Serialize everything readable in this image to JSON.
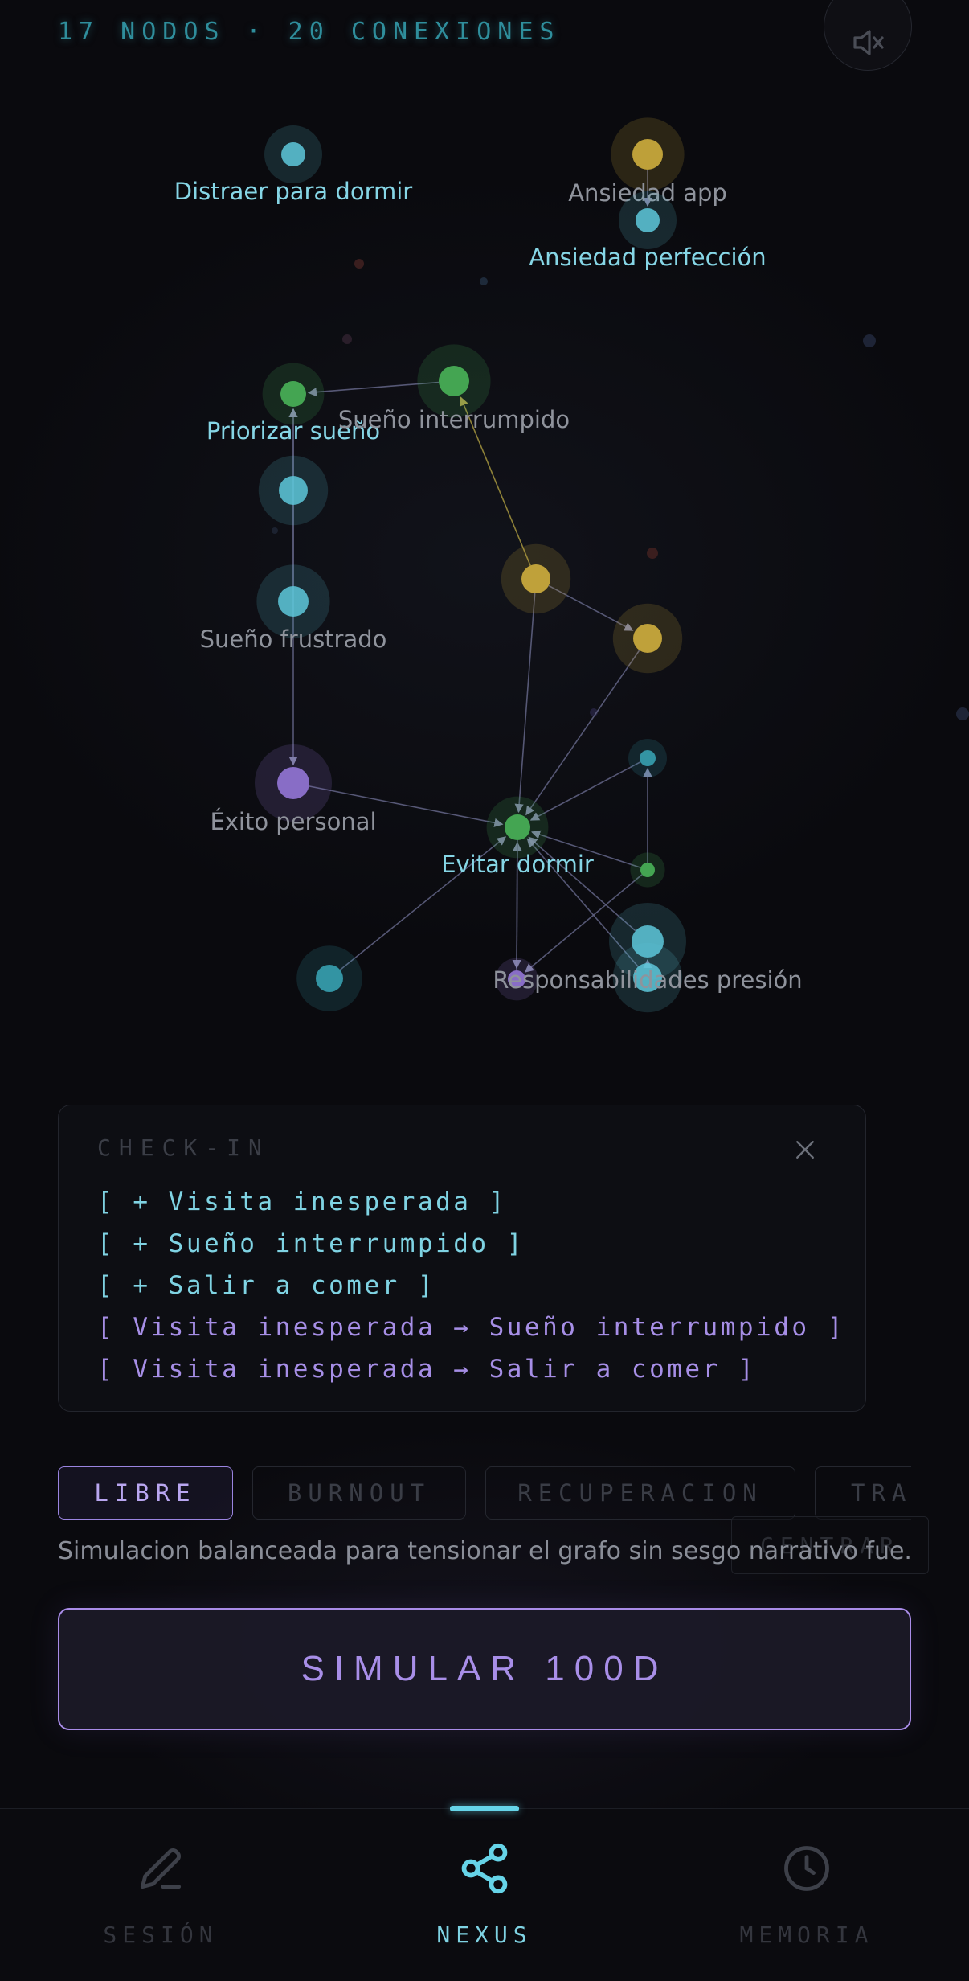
{
  "header": {
    "counts": "17 NODOS · 20 CONEXIONES"
  },
  "colors": {
    "cyan": "#5ec8da",
    "green": "#4cbb5c",
    "yellow": "#d8b640",
    "purple": "#9a7be0",
    "teal": "#3aa8b8"
  },
  "graph": {
    "nodes": [
      {
        "id": "n1",
        "label": "Distraer para dormir",
        "color": "cyan",
        "label_style": "cyan"
      },
      {
        "id": "n2",
        "label": "Ansiedad app",
        "color": "yellow",
        "label_style": "gray"
      },
      {
        "id": "n3",
        "label": "Ansiedad perfección",
        "color": "cyan",
        "label_style": "cyan"
      },
      {
        "id": "n4",
        "label": "Priorizar sueño",
        "color": "green",
        "label_style": "cyan"
      },
      {
        "id": "n5",
        "label": "Sueño interrumpido",
        "color": "green",
        "label_style": "gray"
      },
      {
        "id": "n6",
        "label": "",
        "color": "cyan",
        "label_style": "gray"
      },
      {
        "id": "n7",
        "label": "Sueño frustrado",
        "color": "cyan",
        "label_style": "gray"
      },
      {
        "id": "n8",
        "label": "",
        "color": "yellow",
        "label_style": "gray"
      },
      {
        "id": "n9",
        "label": "",
        "color": "yellow",
        "label_style": "gray"
      },
      {
        "id": "n10",
        "label": "Éxito personal",
        "color": "purple",
        "label_style": "gray"
      },
      {
        "id": "n11",
        "label": "Evitar dormir",
        "color": "green",
        "label_style": "cyan"
      },
      {
        "id": "n12",
        "label": "",
        "color": "teal",
        "label_style": "gray"
      },
      {
        "id": "n13",
        "label": "",
        "color": "green",
        "label_style": "gray"
      },
      {
        "id": "n14",
        "label": "",
        "color": "cyan",
        "label_style": "gray"
      },
      {
        "id": "n15",
        "label": "",
        "color": "cyan",
        "label_style": "gray"
      },
      {
        "id": "n16",
        "label": "",
        "color": "teal",
        "label_style": "gray"
      },
      {
        "id": "n17",
        "label": "Responsabilidades presión",
        "color": "purple",
        "label_style": "gray"
      }
    ],
    "edges": [
      [
        "n5",
        "n4"
      ],
      [
        "n7",
        "n4"
      ],
      [
        "n6",
        "n4"
      ],
      [
        "n8",
        "n5"
      ],
      [
        "n8",
        "n9"
      ],
      [
        "n6",
        "n10"
      ],
      [
        "n10",
        "n11"
      ],
      [
        "n8",
        "n11"
      ],
      [
        "n9",
        "n11"
      ],
      [
        "n12",
        "n11"
      ],
      [
        "n13",
        "n11"
      ],
      [
        "n13",
        "n12"
      ],
      [
        "n14",
        "n11"
      ],
      [
        "n15",
        "n11"
      ],
      [
        "n16",
        "n11"
      ],
      [
        "n17",
        "n11"
      ],
      [
        "n13",
        "n17"
      ],
      [
        "n2",
        "n3"
      ],
      [
        "n15",
        "n14"
      ],
      [
        "n11",
        "n17"
      ]
    ]
  },
  "checkin": {
    "title": "CHECK-IN",
    "lines": [
      {
        "text": "[ + Visita inesperada ]",
        "kind": "add"
      },
      {
        "text": "[ + Sueño interrumpido ]",
        "kind": "add"
      },
      {
        "text": "[ + Salir a comer ]",
        "kind": "add"
      },
      {
        "text": "[ Visita inesperada → Sueño interrumpido ]",
        "kind": "link"
      },
      {
        "text": "[ Visita inesperada → Salir a comer ]",
        "kind": "link"
      }
    ]
  },
  "modes": {
    "tabs": [
      "LIBRE",
      "BURNOUT",
      "RECUPERACION",
      "TRA"
    ],
    "active": 0,
    "description": "Simulacion balanceada para tensionar el grafo sin sesgo narrativo fue..."
  },
  "centrar_label": "CENTRAR",
  "simulate_label": "SIMULAR 100D",
  "nav": {
    "items": [
      {
        "label": "SESIÓN",
        "icon": "pencil-icon"
      },
      {
        "label": "NEXUS",
        "icon": "share-nodes-icon"
      },
      {
        "label": "MEMORIA",
        "icon": "clock-icon"
      }
    ],
    "active": 1
  }
}
